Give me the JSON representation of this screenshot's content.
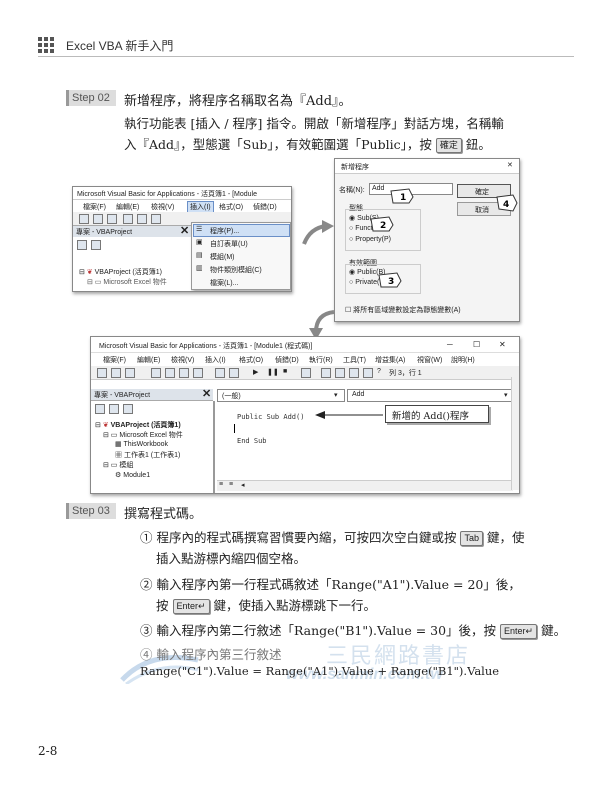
{
  "header": {
    "title": "Excel VBA 新手入門"
  },
  "step02": {
    "tag": "Step 02",
    "line1": "新增程序，將程序名稱取名為『Add』。",
    "line2": "執行功能表 [插入 / 程序] 指令。開啟「新增程序」對話方塊，名稱輸",
    "line3a": "入『Add』，型態選「Sub」，有效範圍選「Public」，按",
    "ok_key": "確定",
    "line3b": "鈕。"
  },
  "vbe_small": {
    "title": "Microsoft Visual Basic for Applications - 活頁簿1 - [Module",
    "menu": [
      "檔案(F)",
      "編輯(E)",
      "檢視(V)",
      "插入(I)",
      "格式(O)",
      "偵錯(D)"
    ],
    "project_title": "專案 - VBAProject",
    "tree": [
      "VBAProject (活頁簿1)",
      "Microsoft Excel 物件"
    ],
    "insert_menu": [
      "程序(P)...",
      "自訂表單(U)",
      "模組(M)",
      "物件類別模組(C)",
      "檔案(L)..."
    ]
  },
  "dialog": {
    "title": "新增程序",
    "name_label": "名稱(N):",
    "name_value": "Add",
    "ok": "確定",
    "cancel": "取消",
    "type_label": "型態",
    "types": [
      "Sub(S)",
      "Function(F)",
      "Property(P)"
    ],
    "scope_label": "有效範圍",
    "scopes": [
      "Public(B)",
      "Private(V)"
    ],
    "static_check": "將所有區域變數設定為靜態變數(A)",
    "callouts": [
      "1",
      "2",
      "3",
      "4"
    ]
  },
  "vbe_large": {
    "title": "Microsoft Visual Basic for Applications - 活頁簿1 - [Module1 (程式碼)]",
    "window_controls": [
      "─",
      "☐",
      "✕"
    ],
    "menu": [
      "檔案(F)",
      "編輯(E)",
      "檢視(V)",
      "插入(I)",
      "格式(O)",
      "偵錯(D)",
      "執行(R)",
      "工具(T)",
      "增益集(A)",
      "視窗(W)",
      "說明(H)"
    ],
    "position": "列 3，行 1",
    "project_title": "專案 - VBAProject",
    "tree": [
      "VBAProject (活頁簿1)",
      "Microsoft Excel 物件",
      "ThisWorkbook",
      "工作表1 (工作表1)",
      "模組",
      "Module1"
    ],
    "combo_left": "(一般)",
    "combo_right": "Add",
    "code": [
      "Public Sub Add()",
      "",
      "End Sub"
    ],
    "annotation": "新增的 Add()程序"
  },
  "step03": {
    "tag": "Step 03",
    "title": "撰寫程式碼。",
    "item1a": "① 程序內的程式碼撰寫習慣要內縮，可按四次空白鍵或按",
    "tab_key": "Tab",
    "item1b": "鍵，使",
    "item1c": "插入點游標內縮四個空格。",
    "item2a": "② 輸入程序內第一行程式碼敘述「Range(\"A1\").Value = 20」後，",
    "item2b": "按",
    "enter_key": "Enter↵",
    "item2c": "鍵，使插入點游標跳下一行。",
    "item3a": "③ 輸入程序內第二行敘述「Range(\"B1\").Value = 30」後，按",
    "item3b": "鍵。",
    "item4": "④ 輸入程序內第三行敘述",
    "code4": "Range(\"C1\").Value = Range(\"A1\").Value + Range(\"B1\").Value"
  },
  "watermark": {
    "name": "三民網路書店",
    "url": "www.sanmin.com.tw"
  },
  "page_number": "2-8"
}
